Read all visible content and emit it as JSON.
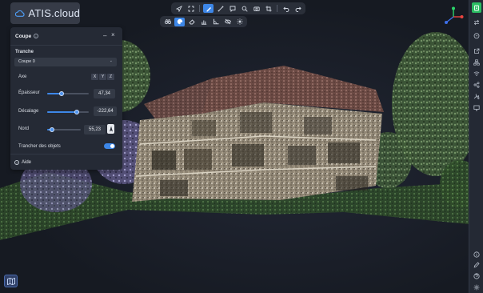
{
  "app": {
    "logo_text": "ATIS.cloud"
  },
  "toolbar_top": {
    "items": [
      "navigate-icon",
      "fit-view-icon",
      "pen-tool-icon",
      "measure-icon",
      "annotation-icon",
      "search-icon",
      "camera-icon",
      "crop-icon",
      "undo-icon",
      "redo-icon"
    ],
    "active": "pen-tool-icon"
  },
  "toolbar_second": {
    "items": [
      "binoculars-icon",
      "palette-icon",
      "eraser-icon",
      "bar-chart-icon",
      "angle-icon",
      "visibility-icon",
      "sun-icon"
    ],
    "active": "palette-icon"
  },
  "panel": {
    "title": "Coupe",
    "section_label": "Tranche",
    "slice_select": {
      "value": "Coupe 0",
      "chevron": "⌄"
    },
    "axis": {
      "label": "Axe",
      "options": [
        "X",
        "Y",
        "Z"
      ]
    },
    "thickness": {
      "label": "Épaisseur",
      "value": "47,34",
      "slider_fraction": 0.34
    },
    "offset": {
      "label": "Décalage",
      "value": "-222,64",
      "slider_fraction": 0.72
    },
    "north": {
      "label": "Nord",
      "value": "55,23",
      "slider_fraction": 0.15
    },
    "slice_objects": {
      "label": "Trancher des objets",
      "enabled": true
    },
    "help_label": "Aide",
    "info_glyph": "i",
    "help_glyph": "?",
    "min_glyph": "–",
    "close_glyph": "×"
  },
  "right_sidebar": {
    "items": [
      "layers-icon",
      "transfer-icon",
      "comment-icon",
      "external-link-icon",
      "network-icon",
      "wifi-icon",
      "share-icon",
      "tools-icon",
      "ruler-icon",
      "monitor-icon",
      "chart-icon",
      "info-icon",
      "pen-icon",
      "help-icon",
      "settings-icon"
    ],
    "active": "layers-icon"
  },
  "colors": {
    "accent": "#3d87e8",
    "active_green": "#2bbd63",
    "panel_bg": "#252a35"
  }
}
